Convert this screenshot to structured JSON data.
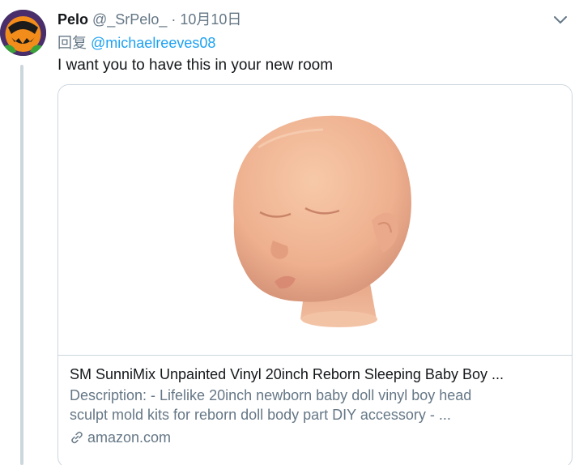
{
  "tweet": {
    "display_name": "Pelo",
    "handle": "@_SrPelo_",
    "separator": "·",
    "date": "10月10日",
    "reply_prefix": "回复",
    "reply_to": "@michaelreeves08",
    "text": "I want you to have this in your new room"
  },
  "card": {
    "title": "SM SunniMix Unpainted Vinyl 20inch Reborn Sleeping Baby Boy ...",
    "description_line1": "Description: - Lifelike 20inch newborn baby doll vinyl boy head",
    "description_line2": "sculpt mold kits for reborn doll body part DIY accessory - ...",
    "domain": "amazon.com"
  },
  "icons": {
    "caret": "chevron-down-icon",
    "link": "link-icon"
  },
  "colors": {
    "link_blue": "#1da1f2",
    "secondary_text": "#657786",
    "border": "#ccd6dd"
  }
}
